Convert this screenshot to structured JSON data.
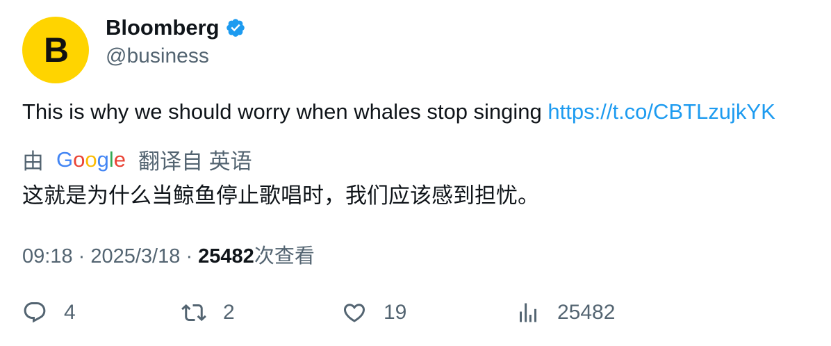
{
  "tweet": {
    "avatar_letter": "B",
    "display_name": "Bloomberg",
    "handle": "@business",
    "text": "This is why we should worry when whales stop singing ",
    "link": "https://t.co/CBTLzujkYK",
    "translate_prefix": "由",
    "translate_provider": "Google",
    "translate_suffix": "翻译自 英语",
    "translated_text": "这就是为什么当鲸鱼停止歌唱时，我们应该感到担忧。",
    "time": "09:18",
    "date": "2025/3/18",
    "views_count": "25482",
    "views_label": "次查看"
  },
  "actions": {
    "replies": "4",
    "retweets": "2",
    "likes": "19",
    "views": "25482"
  },
  "colors": {
    "accent": "#1d9bf0",
    "secondary_text": "#536471",
    "brand_yellow": "#ffd400"
  },
  "icons": [
    "verified-badge-icon",
    "google-logo",
    "reply-icon",
    "retweet-icon",
    "like-icon",
    "views-icon"
  ]
}
